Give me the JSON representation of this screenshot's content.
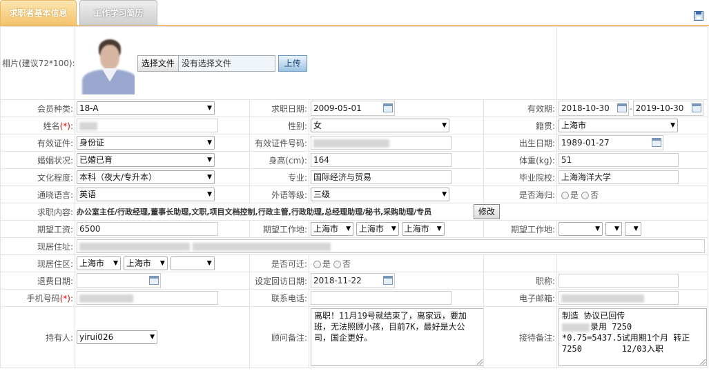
{
  "tabs": {
    "basic": "求职者基本信息",
    "history": "工作学习简历"
  },
  "photo": {
    "label": "相片(建议72*100):",
    "choose_file": "选择文件",
    "no_file": "没有选择文件",
    "upload": "上传"
  },
  "fields": {
    "member_type": {
      "label": "会员种类:",
      "value": "18-A"
    },
    "apply_date": {
      "label": "求职日期:",
      "value": "2009-05-01"
    },
    "valid_period": {
      "label": "有效期:",
      "from": "2018-10-30",
      "sep": "-",
      "to": "2019-10-30"
    },
    "name": {
      "label": "姓名",
      "req": "(*)",
      "colon": ":"
    },
    "gender": {
      "label": "性别:",
      "value": "女"
    },
    "origin": {
      "label": "籍贯:",
      "value": "上海市"
    },
    "id_type": {
      "label": "有效证件:",
      "value": "身份证"
    },
    "id_number": {
      "label": "有效证件号码:"
    },
    "birth": {
      "label": "出生日期:",
      "value": "1989-01-27"
    },
    "marital": {
      "label": "婚姻状况:",
      "value": "已婚已育"
    },
    "height": {
      "label": "身高(cm):",
      "value": "164"
    },
    "weight": {
      "label": "体重(kg):",
      "value": "51"
    },
    "education": {
      "label": "文化程度:",
      "value": "本科（夜大/专升本）"
    },
    "major": {
      "label": "专业:",
      "value": "国际经济与贸易"
    },
    "school": {
      "label": "毕业院校:",
      "value": "上海海洋大学"
    },
    "language": {
      "label": "通晓语言:",
      "value": "英语"
    },
    "lang_level": {
      "label": "外语等级:",
      "value": "三级"
    },
    "returnee": {
      "label": "是否海归:",
      "yes": "是",
      "no": "否"
    },
    "job_content": {
      "label": "求职内容:",
      "value": "办公室主任/行政经理,董事长助理,文职,项目文档控制,行政主管,行政助理,总经理助理/秘书,采购助理/专员",
      "edit": "修改"
    },
    "salary": {
      "label": "期望工资:",
      "value": "6500"
    },
    "work_place1": {
      "label": "期望工作地:",
      "v1": "上海市",
      "v2": "上海市",
      "v3": "上海市"
    },
    "work_place2": {
      "label": "期望工作地:"
    },
    "address": {
      "label": "现居住址:"
    },
    "district": {
      "label": "现居住区:",
      "v1": "上海市",
      "v2": "上海市"
    },
    "visa": {
      "label": "是否可迁:",
      "yes": "是",
      "no": "否"
    },
    "refund_date": {
      "label": "退费日期:"
    },
    "callback_date": {
      "label": "设定回访日期:",
      "value": "2018-11-22"
    },
    "title": {
      "label": "职称:"
    },
    "mobile": {
      "label": "手机号码",
      "req": "(*)",
      "colon": ":"
    },
    "phone": {
      "label": "联系电话:"
    },
    "email": {
      "label": "电子邮箱:"
    },
    "owner": {
      "label": "持有人:",
      "value": "yirui026"
    },
    "advisor_note": {
      "label": "顾问备注:",
      "value": "离职！11月19号就结束了，离家远，要加班，无法照顾小孩，目前7K，最好是大公司，国企更好。"
    },
    "reception_note": {
      "label": "接待备注:",
      "line1": "制造 协议已回传",
      "line2": "录用 7250",
      "line3": "*0.75=5437.5试用期1个月 转正",
      "line4": "7250        12/03入职"
    }
  },
  "icons": {
    "save": "save-icon",
    "calendar": "calendar-icon",
    "dropdown": "chevron-down-icon"
  }
}
